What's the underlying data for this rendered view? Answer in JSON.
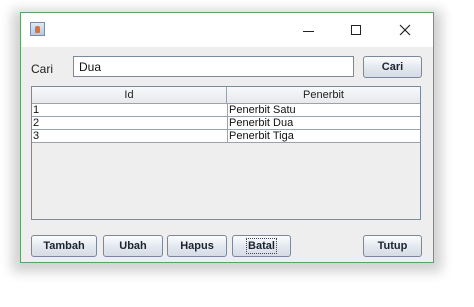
{
  "window": {
    "title": ""
  },
  "search": {
    "label": "Cari",
    "value": "Dua",
    "button_label": "Cari"
  },
  "table": {
    "columns": [
      "Id",
      "Penerbit"
    ],
    "rows": [
      {
        "id": "1",
        "penerbit": "Penerbit Satu"
      },
      {
        "id": "2",
        "penerbit": "Penerbit Dua"
      },
      {
        "id": "3",
        "penerbit": "Penerbit Tiga"
      }
    ]
  },
  "buttons": {
    "tambah": "Tambah",
    "ubah": "Ubah",
    "hapus": "Hapus",
    "batal": "Batal",
    "tutup": "Tutup"
  },
  "icons": {
    "app": "java-app-icon",
    "minimize": "minimize-icon",
    "maximize": "maximize-icon",
    "close": "close-icon"
  },
  "colors": {
    "window_border": "#5fa06a",
    "background": "#eeeeee"
  }
}
